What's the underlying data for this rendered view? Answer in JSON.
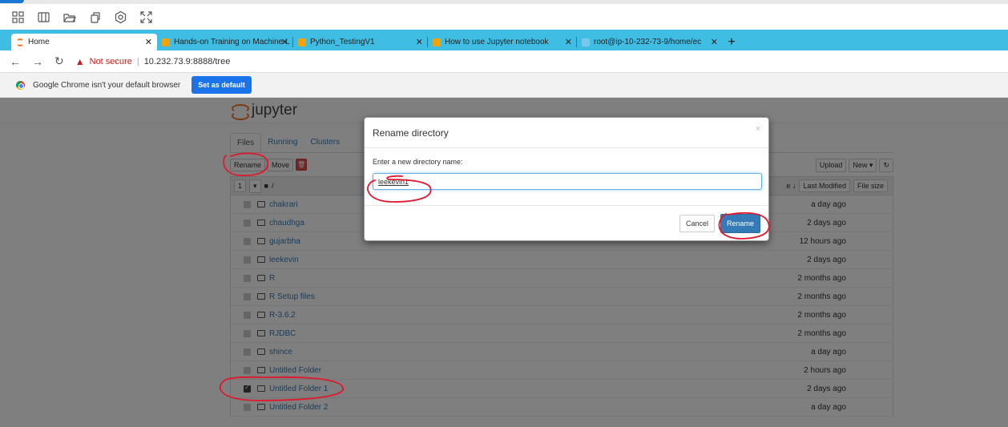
{
  "browser": {
    "tabs": [
      {
        "label": "Home",
        "active": true
      },
      {
        "label": "Hands-on Training on Machine L"
      },
      {
        "label": "Python_TestingV1"
      },
      {
        "label": "How to use Jupyter notebook"
      },
      {
        "label": "root@ip-10-232-73-9/home/ec"
      }
    ],
    "new_tab": "+",
    "not_secure": "Not secure",
    "url": "10.232.73.9:8888/tree",
    "infobar_text": "Google Chrome isn't your default browser",
    "set_default": "Set as default"
  },
  "jupyter": {
    "logo_text": "jupyter",
    "tabs": [
      "Files",
      "Running",
      "Clusters"
    ],
    "rename_btn": "Rename",
    "move_btn": "Move",
    "upload_btn": "Upload",
    "new_btn": "New ▾",
    "select_count": "1",
    "path": "/",
    "col_name_sort": "e ↓",
    "col_last_modified": "Last Modified",
    "col_file_size": "File size",
    "files": [
      {
        "name": "chakrari",
        "modified": "a day ago",
        "checked": false
      },
      {
        "name": "chaudhga",
        "modified": "2 days ago",
        "checked": false
      },
      {
        "name": "gujarbha",
        "modified": "12 hours ago",
        "checked": false
      },
      {
        "name": "leekevin",
        "modified": "2 days ago",
        "checked": false
      },
      {
        "name": "R",
        "modified": "2 months ago",
        "checked": false
      },
      {
        "name": "R Setup files",
        "modified": "2 months ago",
        "checked": false
      },
      {
        "name": "R-3.6.2",
        "modified": "2 months ago",
        "checked": false
      },
      {
        "name": "RJDBC",
        "modified": "2 months ago",
        "checked": false
      },
      {
        "name": "shince",
        "modified": "a day ago",
        "checked": false
      },
      {
        "name": "Untitled Folder",
        "modified": "2 hours ago",
        "checked": false
      },
      {
        "name": "Untitled Folder 1",
        "modified": "2 days ago",
        "checked": true
      },
      {
        "name": "Untitled Folder 2",
        "modified": "a day ago",
        "checked": false
      }
    ]
  },
  "modal": {
    "title": "Rename directory",
    "close": "×",
    "label": "Enter a new directory name:",
    "value": "leekevin1",
    "cancel": "Cancel",
    "rename": "Rename"
  },
  "colors": {
    "tabbar": "#3fbde3",
    "jupyter_orange": "#f37726",
    "primary": "#337ab7",
    "annotation_red": "#e0182d"
  }
}
